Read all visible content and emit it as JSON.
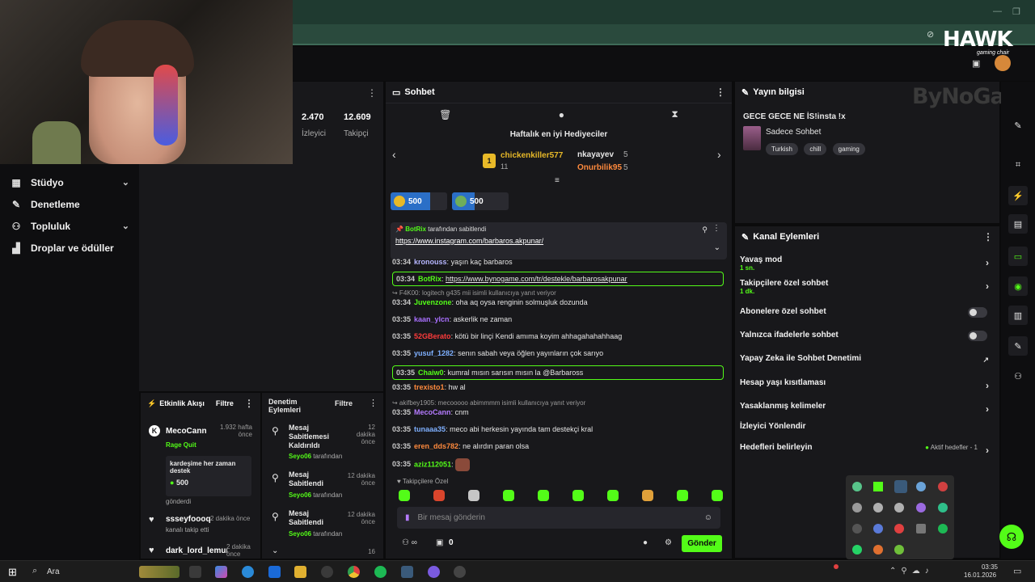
{
  "stats": {
    "viewers_value": "2.470",
    "viewers_label": "İzleyici",
    "followers_value": "12.609",
    "followers_label": "Takipçi"
  },
  "sidebar": {
    "items": [
      {
        "label": "Stüdyo",
        "icon": "grid-icon",
        "chevron": true
      },
      {
        "label": "Denetleme",
        "icon": "wrench-icon",
        "chevron": false
      },
      {
        "label": "Topluluk",
        "icon": "people-icon",
        "chevron": true
      },
      {
        "label": "Droplar ve ödüller",
        "icon": "gift-icon",
        "chevron": false
      }
    ]
  },
  "chat": {
    "title": "Sohbet",
    "gifters_title": "Haftalık en iyi Hediyeciler",
    "top_gifter": {
      "name": "chickenkiller577",
      "count": "11"
    },
    "gifter2": {
      "name": "nkayayev",
      "count": "5"
    },
    "gifter3": {
      "name": "Onurbilik95",
      "count": "5"
    },
    "pill1": "500",
    "pill2": "500",
    "pinned_by": "BotRix",
    "pinned_suffix": "tarafından sabitlendi",
    "pinned_link": "https://www.instagram.com/barbaros.akpunar/",
    "messages": [
      {
        "time": "03:34",
        "user": "kronouss",
        "color": "#b7b7ff",
        "text": "yaşın kaç barbaros"
      },
      {
        "time": "03:34",
        "user": "BotRix",
        "color": "#53fc18",
        "text": "https://www.bynogame.com/tr/destekle/barbarosakpunar",
        "highlight": true
      },
      {
        "reply": "F4K00: logitech g435 mii isimli kullanıcıya yanıt veriyor"
      },
      {
        "time": "03:34",
        "user": "Juvenzone",
        "color": "#53fc18",
        "text": "oha aq oysa renginin solmuşluk dozunda"
      },
      {
        "time": "03:35",
        "user": "kaan_ylcn",
        "color": "#a970ff",
        "text": "askerlik ne zaman"
      },
      {
        "time": "03:35",
        "user": "52GBerato",
        "color": "#ff3b3b",
        "text": "kötü bir linçi Kendi amıma koyim ahhagahahahhaag"
      },
      {
        "time": "03:35",
        "user": "yusuf_1282",
        "color": "#7fb0ff",
        "text": "senın sabah veya öğlen yayınların çok sarıyo"
      },
      {
        "time": "03:35",
        "user": "Chaiw0",
        "color": "#53fc18",
        "text": "kumral mısın sarısın mısın la @Barbaross",
        "highlight": true
      },
      {
        "time": "03:35",
        "user": "trexisto1",
        "color": "#ff8a3d",
        "text": "hw al"
      },
      {
        "reply": "akifbey1905: mecooooo abimmmm isimli kullanıcıya yanıt veriyor"
      },
      {
        "time": "03:35",
        "user": "MecoCann",
        "color": "#b57bff",
        "text": "cnm"
      },
      {
        "time": "03:35",
        "user": "tunaaa35",
        "color": "#7fb0ff",
        "text": "meco abi herkesin yayında tam destekçi kral"
      },
      {
        "time": "03:35",
        "user": "eren_dds782",
        "color": "#ff8a3d",
        "text": "ne alırdın paran olsa"
      },
      {
        "time": "03:35",
        "user": "aziz112051",
        "color": "#53fc18",
        "text": ""
      }
    ],
    "followers_only": "Takipçilere Özel",
    "input_placeholder": "Bir mesaj gönderin",
    "counter": "0",
    "send_label": "Gönder"
  },
  "stream_info": {
    "title_label": "Yayın bilgisi",
    "title": "GECE GECE NE İS!insta !x",
    "category": "Sadece Sohbet",
    "tags": [
      "Turkish",
      "chill",
      "gaming"
    ]
  },
  "channel_actions": {
    "title": "Kanal Eylemleri",
    "slow_mode": "Yavaş mod",
    "slow_mode_sub": "1 sn.",
    "followers_only": "Takipçilere özel sohbet",
    "followers_only_sub": "1 dk.",
    "subs_only": "Abonelere özel sohbet",
    "emotes_only": "Yalnızca ifadelerle sohbet",
    "ai_moderation": "Yapay Zeka ile Sohbet Denetimi",
    "age_restrict": "Hesap yaşı kısıtlaması",
    "banned_words": "Yasaklanmış kelimeler",
    "redirect": "İzleyici Yönlendir",
    "goals": "Hedefleri belirleyin",
    "goals_status": "Aktif hedefler - 1"
  },
  "activity": {
    "title": "Etkinlik Akışı",
    "filter": "Filtre",
    "e1_name": "MecoCann",
    "e1_time": "1.932 hafta önce",
    "e1_action": "Rage Quit",
    "e1_note": "kardeşime her zaman destek",
    "e1_amount": "500",
    "e1_sent": "gönderdi",
    "e2_name": "ssseyfoooq",
    "e2_time": "2 dakika önce",
    "e2_action": "kanalı takip etti",
    "e3_name": "dark_lord_lemur",
    "e3_time": "2 dakika önce"
  },
  "modlog": {
    "title": "Denetim Eylemleri",
    "filter": "Filtre",
    "i1_title": "Mesaj Sabitlemesi Kaldırıldı",
    "i1_time": "12 dakika önce",
    "i1_by": "Seyo06",
    "i1_suffix": "tarafından",
    "i2_title": "Mesaj Sabitlendi",
    "i2_time": "12 dakika önce",
    "i2_by": "Seyo06",
    "i2_suffix": "tarafından",
    "i3_title": "Mesaj Sabitlendi",
    "i3_time": "12 dakika önce",
    "i3_by": "Seyo06",
    "i3_suffix": "tarafından",
    "i4_time": "16"
  },
  "overlay": {
    "hawk": "HAWK",
    "hawk_sub": "gaming chair",
    "bynogame": "ByNoGame"
  },
  "taskbar": {
    "search": "Ara",
    "time": "03:35",
    "date": "16.01.2026"
  }
}
